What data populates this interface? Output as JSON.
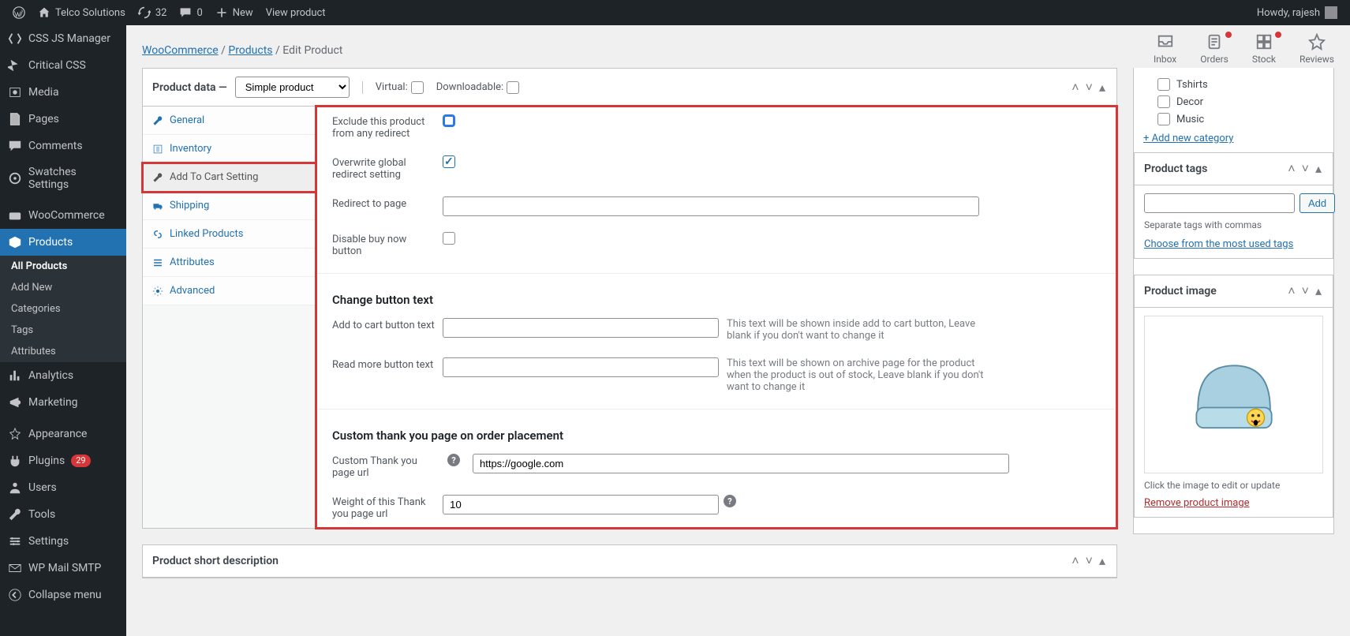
{
  "adminbar": {
    "site": "Telco Solutions",
    "updates": "32",
    "comments": "0",
    "new": "New",
    "view": "View product",
    "howdy": "Howdy, rajesh"
  },
  "sidebar": {
    "items": [
      {
        "label": "CSS JS Manager"
      },
      {
        "label": "Critical CSS"
      },
      {
        "label": "Media"
      },
      {
        "label": "Pages"
      },
      {
        "label": "Comments"
      },
      {
        "label": "Swatches Settings"
      },
      {
        "label": "WooCommerce"
      },
      {
        "label": "Products"
      },
      {
        "label": "Analytics"
      },
      {
        "label": "Marketing"
      },
      {
        "label": "Appearance"
      },
      {
        "label": "Plugins",
        "badge": "29"
      },
      {
        "label": "Users"
      },
      {
        "label": "Tools"
      },
      {
        "label": "Settings"
      },
      {
        "label": "WP Mail SMTP"
      },
      {
        "label": "Collapse menu"
      }
    ],
    "sub": {
      "all": "All Products",
      "add": "Add New",
      "cat": "Categories",
      "tags": "Tags",
      "attr": "Attributes"
    }
  },
  "breadcrumb": {
    "woo": "WooCommerce",
    "prod": "Products",
    "edit": "Edit Product"
  },
  "quick": {
    "inbox": "Inbox",
    "orders": "Orders",
    "stock": "Stock",
    "reviews": "Reviews"
  },
  "productdata": {
    "title": "Product data —",
    "type": "Simple product",
    "virtual": "Virtual:",
    "downloadable": "Downloadable:"
  },
  "tabs": {
    "general": "General",
    "inventory": "Inventory",
    "addtocart": "Add To Cart Setting",
    "shipping": "Shipping",
    "linked": "Linked Products",
    "attributes": "Attributes",
    "advanced": "Advanced"
  },
  "fields": {
    "exclude": "Exclude this product from any redirect",
    "overwrite": "Overwrite global redirect setting",
    "redirect": "Redirect to page",
    "disable": "Disable buy now button",
    "h1": "Change button text",
    "addtext": "Add to cart button text",
    "addhelp": "This text will be shown inside add to cart button, Leave blank if you don't want to change it",
    "readtext": "Read more button text",
    "readhelp": "This text will be shown on archive page for the product when the product is out of stock, Leave blank if you don't want to change it",
    "h2": "Custom thank you page on order placement",
    "custurl": "Custom Thank you page url",
    "custurl_val": "https://google.com",
    "weight": "Weight of this Thank you page url",
    "weight_val": "10"
  },
  "shortdesc": "Product short description",
  "cats": {
    "tshirts": "Tshirts",
    "decor": "Decor",
    "music": "Music",
    "add": "+ Add new category"
  },
  "tags": {
    "title": "Product tags",
    "add": "Add",
    "sep": "Separate tags with commas",
    "choose": "Choose from the most used tags"
  },
  "img": {
    "title": "Product image",
    "click": "Click the image to edit or update",
    "remove": "Remove product image"
  }
}
